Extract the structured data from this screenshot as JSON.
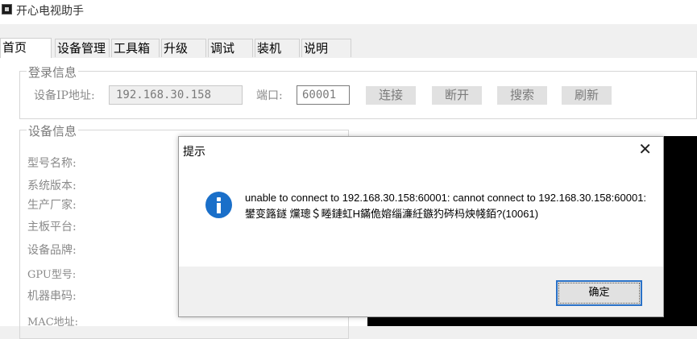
{
  "app": {
    "title": "开心电视助手"
  },
  "tabs": [
    "首页",
    "设备管理",
    "工具箱",
    "升级",
    "调试",
    "装机",
    "说明"
  ],
  "login_group": {
    "legend": "登录信息",
    "ip_label": "设备IP地址:",
    "ip_value": "192.168.30.158",
    "port_label": "端口:",
    "port_value": "60001",
    "buttons": {
      "connect": "连接",
      "disconnect": "断开",
      "search": "搜索",
      "refresh": "刷新"
    }
  },
  "device_group": {
    "legend": "设备信息",
    "fields": [
      "型号名称:",
      "系统版本:",
      "生产厂家:",
      "主板平台:",
      "设备品牌:",
      "GPU型号:",
      "机器串码:",
      "MAC地址:"
    ]
  },
  "dialog": {
    "title": "提示",
    "close": "✕",
    "icon": "info-icon",
    "message": "unable to connect to 192.168.30.158:60001: cannot connect to 192.168.30.158:60001: 鐢变簬鐩   爣璁＄畻鏈虹Н鏋佹嫆缁濓紝鏃犳硶杩炴帴銆?(10061)",
    "ok": "确定"
  }
}
